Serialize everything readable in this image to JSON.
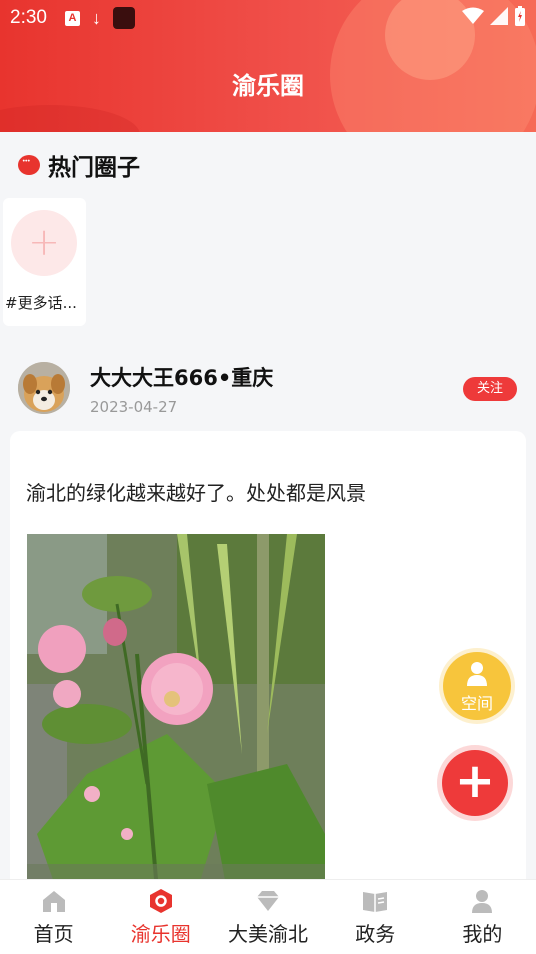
{
  "status_bar": {
    "time": "2:30",
    "a_badge": "A",
    "download_glyph": "↓",
    "icons": [
      "notification-a-icon",
      "download-icon",
      "app-icon",
      "wifi-icon",
      "signal-icon",
      "battery-icon"
    ]
  },
  "header": {
    "title": "渝乐圈"
  },
  "hot_circles": {
    "title": "热门圈子",
    "more_label": "#更多话...",
    "plus_glyph": "+"
  },
  "post": {
    "username": "大大大王666•重庆",
    "date": "2023-04-27",
    "follow_label": "关注",
    "text": "渝北的绿化越来越好了。处处都是风景"
  },
  "fab": {
    "space_label": "空间",
    "add_glyph": "+"
  },
  "bottom_nav": {
    "items": [
      {
        "label": "首页",
        "icon": "home-icon"
      },
      {
        "label": "渝乐圈",
        "icon": "circle-hex-icon"
      },
      {
        "label": "大美渝北",
        "icon": "diamond-icon"
      },
      {
        "label": "政务",
        "icon": "book-icon"
      },
      {
        "label": "我的",
        "icon": "profile-icon"
      }
    ],
    "active": "渝乐圈"
  },
  "colors": {
    "accent": "#e8342e",
    "fab_space": "#f7c53c",
    "background": "#f5f6f8"
  }
}
